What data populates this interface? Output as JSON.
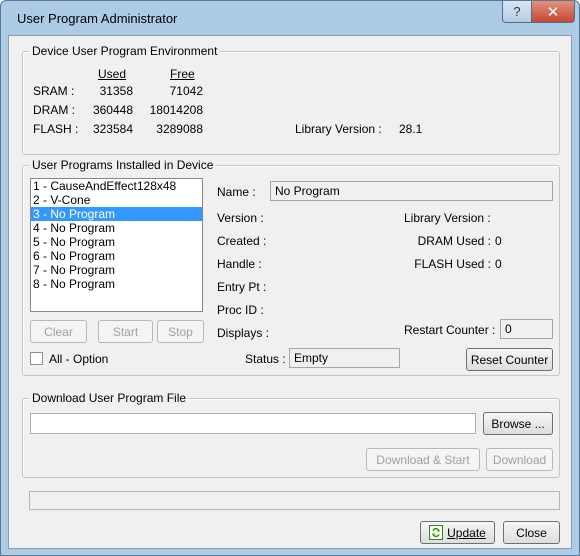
{
  "window": {
    "title": "User Program Administrator",
    "help_symbol": "?",
    "close_symbol": "✕"
  },
  "environment": {
    "legend": "Device User Program Environment",
    "col_used": "Used",
    "col_free": "Free",
    "rows": [
      {
        "label": "SRAM :",
        "used": "31358",
        "free": "71042"
      },
      {
        "label": "DRAM :",
        "used": "360448",
        "free": "18014208"
      },
      {
        "label": "FLASH :",
        "used": "323584",
        "free": "3289088"
      }
    ],
    "library_version_label": "Library Version :",
    "library_version_value": "28.1"
  },
  "installed": {
    "legend": "User Programs Installed in Device",
    "programs": [
      "1 - CauseAndEffect128x48",
      "2 - V-Cone",
      "3 - No Program",
      "4 - No Program",
      "5 - No Program",
      "6 - No Program",
      "7 - No Program",
      "8 - No Program"
    ],
    "selected_index": 2,
    "clear_label": "Clear",
    "start_label": "Start",
    "stop_label": "Stop",
    "all_option_label": "All - Option",
    "all_option_checked": false,
    "name_label": "Name :",
    "name_value": "No Program",
    "version_label": "Version :",
    "created_label": "Created :",
    "handle_label": "Handle :",
    "entry_pt_label": "Entry Pt :",
    "proc_id_label": "Proc ID :",
    "displays_label": "Displays :",
    "library_version_label": "Library Version :",
    "dram_used_label": "DRAM Used :",
    "dram_used_value": "0",
    "flash_used_label": "FLASH Used :",
    "flash_used_value": "0",
    "restart_counter_label": "Restart Counter :",
    "restart_counter_value": "0",
    "status_label": "Status :",
    "status_value": "Empty",
    "reset_counter_label": "Reset Counter"
  },
  "download": {
    "legend": "Download User Program File",
    "file_path": "",
    "browse_label": "Browse ...",
    "download_start_label": "Download & Start",
    "download_label": "Download"
  },
  "footer": {
    "status_text": "",
    "update_label": "Update",
    "close_label": "Close",
    "update_icon": "update-refresh-icon"
  }
}
